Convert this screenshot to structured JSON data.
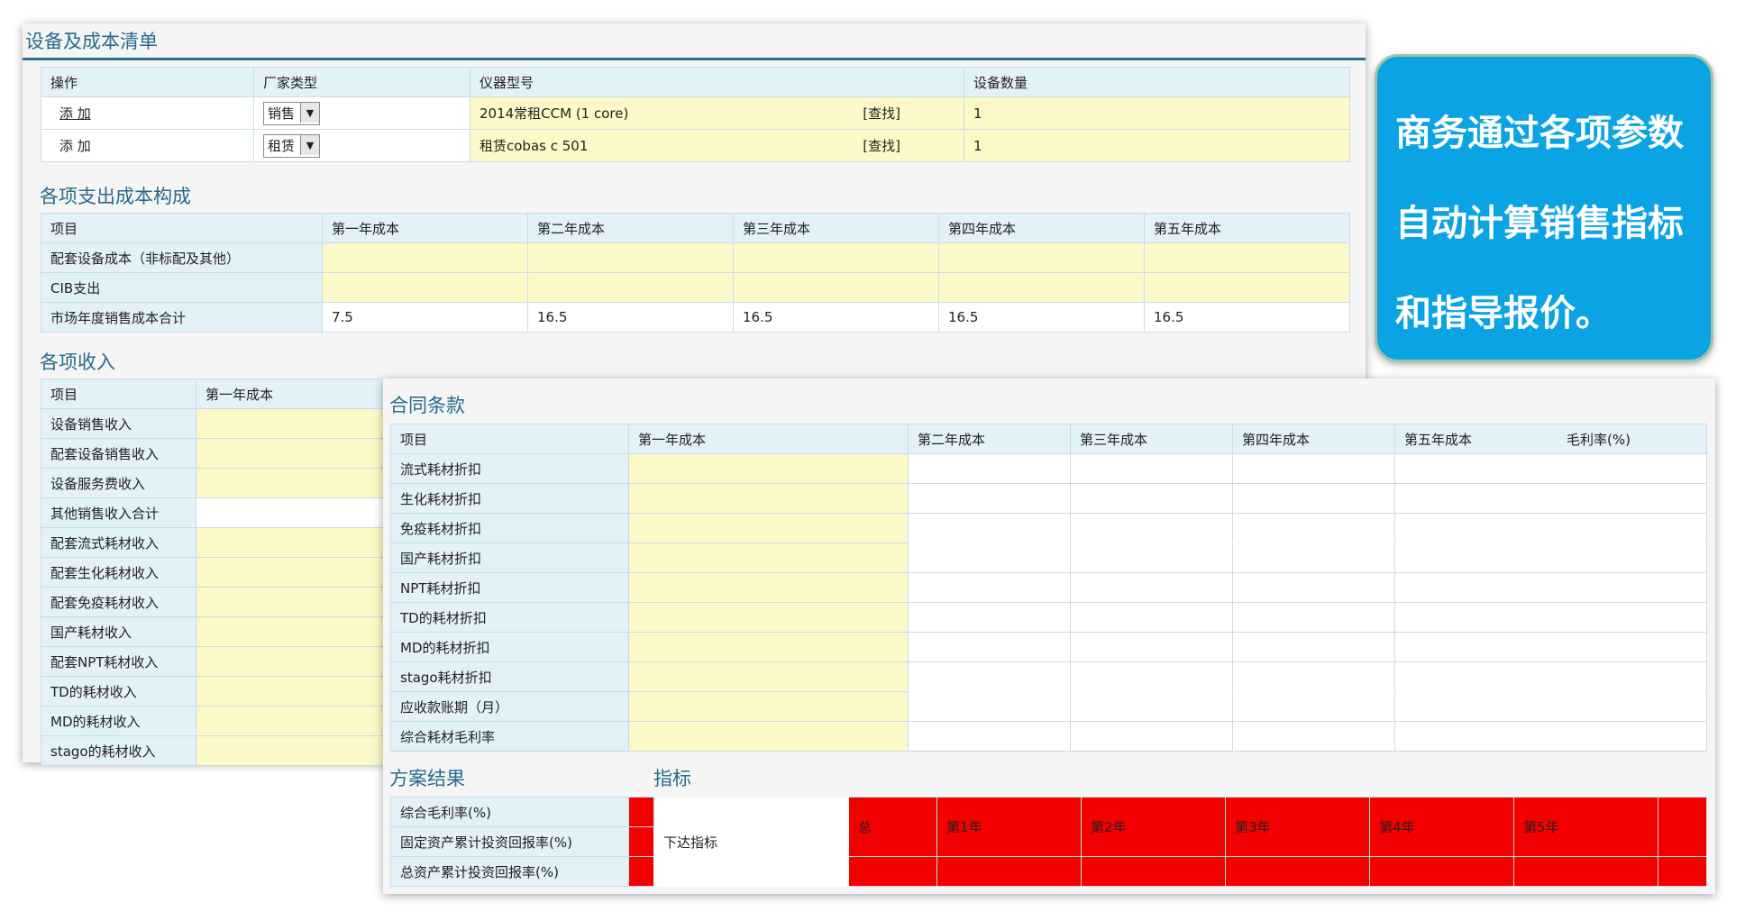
{
  "equipment": {
    "title": "设备及成本清单",
    "headers": [
      "操作",
      "厂家类型",
      "仪器型号",
      "设备数量"
    ],
    "rows": [
      {
        "action": "添 加",
        "type": "销售",
        "model": "2014常租CCM (1 core)",
        "find": "[查找]",
        "qty": "1"
      },
      {
        "action": "添 加",
        "type": "租赁",
        "model": "租赁cobas c 501",
        "find": "[查找]",
        "qty": "1"
      }
    ]
  },
  "costs": {
    "title": "各项支出成本构成",
    "headers": [
      "项目",
      "第一年成本",
      "第二年成本",
      "第三年成本",
      "第四年成本",
      "第五年成本"
    ],
    "rows": [
      {
        "label": "配套设备成本（非标配及其他）",
        "values": [
          "",
          "",
          "",
          "",
          ""
        ]
      },
      {
        "label": "CIB支出",
        "values": [
          "",
          "",
          "",
          "",
          ""
        ]
      },
      {
        "label": "市场年度销售成本合计",
        "values": [
          "7.5",
          "16.5",
          "16.5",
          "16.5",
          "16.5"
        ]
      }
    ]
  },
  "income": {
    "title": "各项收入",
    "headers": [
      "项目",
      "第一年成本"
    ],
    "rows": [
      "设备销售收入",
      "配套设备销售收入",
      "设备服务费收入",
      "其他销售收入合计",
      "配套流式耗材收入",
      "配套生化耗材收入",
      "配套免疫耗材收入",
      "国产耗材收入",
      "配套NPT耗材收入",
      "TD的耗材收入",
      "MD的耗材收入",
      "stago的耗材收入"
    ]
  },
  "contract": {
    "title": "合同条款",
    "headers": [
      "项目",
      "第一年成本",
      "第二年成本",
      "第三年成本",
      "第四年成本",
      "第五年成本",
      "毛利率(%)"
    ],
    "rows": [
      "流式耗材折扣",
      "生化耗材折扣",
      "免疫耗材折扣",
      "国产耗材折扣",
      "NPT耗材折扣",
      "TD的耗材折扣",
      "MD的耗材折扣",
      "stago耗材折扣",
      "应收款账期（月）",
      "综合耗材毛利率"
    ]
  },
  "results": {
    "title": "方案结果",
    "rows": [
      "综合毛利率(%)",
      "固定资产累计投资回报率(%)",
      "总资产累计投资回报率(%)"
    ]
  },
  "indicators": {
    "title": "指标",
    "label": "下达指标",
    "headers": [
      "总",
      "第1年",
      "第2年",
      "第3年",
      "第4年",
      "第5年",
      ""
    ]
  },
  "callout": {
    "lines": [
      "商务通过各项参数",
      "自动计算销售指标",
      "和指导报价。"
    ]
  },
  "colors": {
    "header_bg": "#e3f1f8",
    "input_bg": "#fdf8c8",
    "alert_red": "#f30000",
    "title_blue": "#2a6a8c",
    "callout_bg": "#0aa3e4"
  }
}
